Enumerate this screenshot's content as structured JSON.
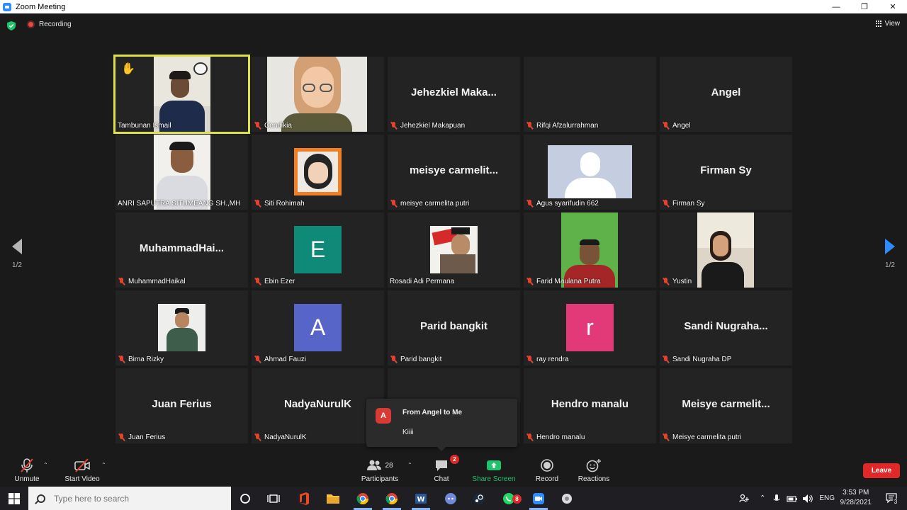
{
  "window": {
    "title": "Zoom Meeting",
    "controls": [
      "—",
      "❐",
      "✕"
    ]
  },
  "meeting": {
    "recording_label": "Recording",
    "view_label": "View"
  },
  "pagination": {
    "left": "1/2",
    "right": "1/2"
  },
  "tiles": [
    {
      "label": "Tambunan Ismail",
      "big": ""
    },
    {
      "label": "Cendikia",
      "big": ""
    },
    {
      "label": "Jehezkiel Makapuan",
      "big": "Jehezkiel  Maka..."
    },
    {
      "label": "Rifqi Afzalurrahman",
      "big": ""
    },
    {
      "label": "Angel",
      "big": "Angel"
    },
    {
      "label": "ANRI SAPUTRA SITUMEANG SH.,MH",
      "big": ""
    },
    {
      "label": "Siti Rohimah",
      "big": ""
    },
    {
      "label": "meisye carmelita putri",
      "big": "meisye  carmelit..."
    },
    {
      "label": "Agus syarifudin 662",
      "big": ""
    },
    {
      "label": "Firman Sy",
      "big": "Firman Sy"
    },
    {
      "label": "MuhammadHaikal",
      "big": "MuhammadHai..."
    },
    {
      "label": "Ebin Ezer",
      "big": "",
      "avatar": "E",
      "avatar_color": "#0f8a78"
    },
    {
      "label": "Rosadi Adi Permana",
      "big": ""
    },
    {
      "label": "Farid Maulana Putra",
      "big": ""
    },
    {
      "label": "Yustin",
      "big": ""
    },
    {
      "label": "Bima Rizky",
      "big": ""
    },
    {
      "label": "Ahmad Fauzi",
      "big": "",
      "avatar": "A",
      "avatar_color": "#5865c8"
    },
    {
      "label": "Parid bangkit",
      "big": "Parid bangkit"
    },
    {
      "label": "ray rendra",
      "big": "",
      "avatar": "r",
      "avatar_color": "#e23a78"
    },
    {
      "label": "Sandi Nugraha DP",
      "big": "Sandi  Nugraha..."
    },
    {
      "label": "Juan Ferius",
      "big": "Juan Ferius"
    },
    {
      "label": "NadyaNurulK",
      "big": "NadyaNurulK"
    },
    {
      "label": "",
      "big": ""
    },
    {
      "label": "Hendro manalu",
      "big": "Hendro manalu"
    },
    {
      "label": "Meisye carmelita putri",
      "big": "Meisye  carmelit..."
    }
  ],
  "chat_popup": {
    "avatar_letter": "A",
    "from": "From Angel to Me",
    "message": "Kiiii"
  },
  "toolbar": {
    "unmute": "Unmute",
    "start_video": "Start Video",
    "participants": "Participants",
    "participants_count": "28",
    "chat": "Chat",
    "chat_badge": "2",
    "share_screen": "Share Screen",
    "record": "Record",
    "reactions": "Reactions",
    "leave": "Leave"
  },
  "taskbar": {
    "search_placeholder": "Type here to search",
    "lang": "ENG",
    "time": "3:53 PM",
    "date": "9/28/2021",
    "whatsapp_badge": "8",
    "notif_badge": "3"
  },
  "colors": {
    "accent": "#2d8cff",
    "active_speaker": "#dfe14a",
    "leave": "#e02828",
    "share": "#1fc36b"
  }
}
